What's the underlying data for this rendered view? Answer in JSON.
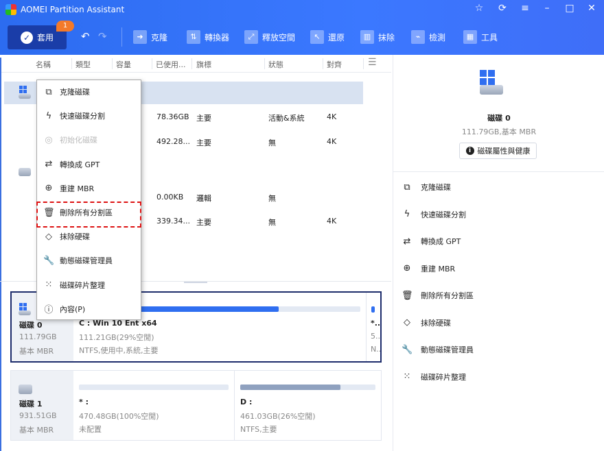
{
  "app": {
    "title": "AOMEI Partition Assistant",
    "window_buttons": [
      "☆",
      "⟳",
      "≡",
      "–",
      "□",
      "✕"
    ]
  },
  "toolbar": {
    "apply": "套用",
    "badge": "1",
    "undo": "↶",
    "redo": "↷",
    "items": [
      {
        "label": "克隆",
        "icon": "clone-icon"
      },
      {
        "label": "轉換器",
        "icon": "convert-icon"
      },
      {
        "label": "釋放空間",
        "icon": "free-space-icon"
      },
      {
        "label": "還原",
        "icon": "restore-icon"
      },
      {
        "label": "抹除",
        "icon": "wipe-icon"
      },
      {
        "label": "檢測",
        "icon": "test-icon"
      },
      {
        "label": "工具",
        "icon": "tools-icon"
      }
    ]
  },
  "table": {
    "headers": [
      "名稱",
      "類型",
      "容量",
      "已使用...",
      "旗標",
      "狀態",
      "對齊"
    ],
    "rows": [
      {
        "used": "78.36GB",
        "type": "主要",
        "status": "活動&系統",
        "align": "4K"
      },
      {
        "used": "492.28...",
        "type": "主要",
        "status": "無",
        "align": "4K"
      },
      {
        "used": "0.00KB",
        "type": "邏輯",
        "status": "無",
        "align": ""
      },
      {
        "used": "339.34...",
        "type": "主要",
        "status": "無",
        "align": "4K"
      }
    ]
  },
  "context_menu": [
    {
      "label": "克隆磁碟",
      "icon": "⧉"
    },
    {
      "label": "快速磁碟分割",
      "icon": "ϟ"
    },
    {
      "label": "初始化磁碟",
      "icon": "◎",
      "disabled": true
    },
    {
      "label": "轉換成 GPT",
      "icon": "⇄"
    },
    {
      "label": "重建 MBR",
      "icon": "⊕"
    },
    {
      "label": "刪除所有分割區",
      "icon": "🗑"
    },
    {
      "label": "抹除硬碟",
      "icon": "◇"
    },
    {
      "label": "動態磁碟管理員",
      "icon": "🔧"
    },
    {
      "label": "磁碟碎片整理",
      "icon": "⁙"
    },
    {
      "label": "內容(P)",
      "icon": "ⓘ"
    }
  ],
  "disks": [
    {
      "name": "磁碟 0",
      "size": "111.79GB",
      "type": "基本 MBR",
      "partitions": [
        {
          "label": "C : Win 10 Ent x64",
          "size": "111.21GB(29%空閒)",
          "info": "NTFS,使用中,系統,主要",
          "used_pct": 71
        },
        {
          "label": "*...",
          "size": "5...",
          "info": "N..."
        }
      ]
    },
    {
      "name": "磁碟 1",
      "size": "931.51GB",
      "type": "基本 MBR",
      "partitions": [
        {
          "label": "* :",
          "size": "470.48GB(100%空閒)",
          "info": "未配置",
          "used_pct": 0
        },
        {
          "label": "D :",
          "size": "461.03GB(26%空閒)",
          "info": "NTFS,主要",
          "used_pct": 74
        }
      ]
    }
  ],
  "right_panel": {
    "disk_name": "磁碟 0",
    "disk_info": "111.79GB,基本 MBR",
    "properties_button": "磁碟屬性與健康",
    "actions": [
      {
        "label": "克隆磁碟",
        "icon": "⧉"
      },
      {
        "label": "快速磁碟分割",
        "icon": "ϟ"
      },
      {
        "label": "轉換成 GPT",
        "icon": "⇄"
      },
      {
        "label": "重建 MBR",
        "icon": "⊕"
      },
      {
        "label": "刪除所有分割區",
        "icon": "🗑"
      },
      {
        "label": "抹除硬碟",
        "icon": "◇"
      },
      {
        "label": "動態磁碟管理員",
        "icon": "🔧"
      },
      {
        "label": "磁碟碎片整理",
        "icon": "⁙"
      }
    ]
  }
}
